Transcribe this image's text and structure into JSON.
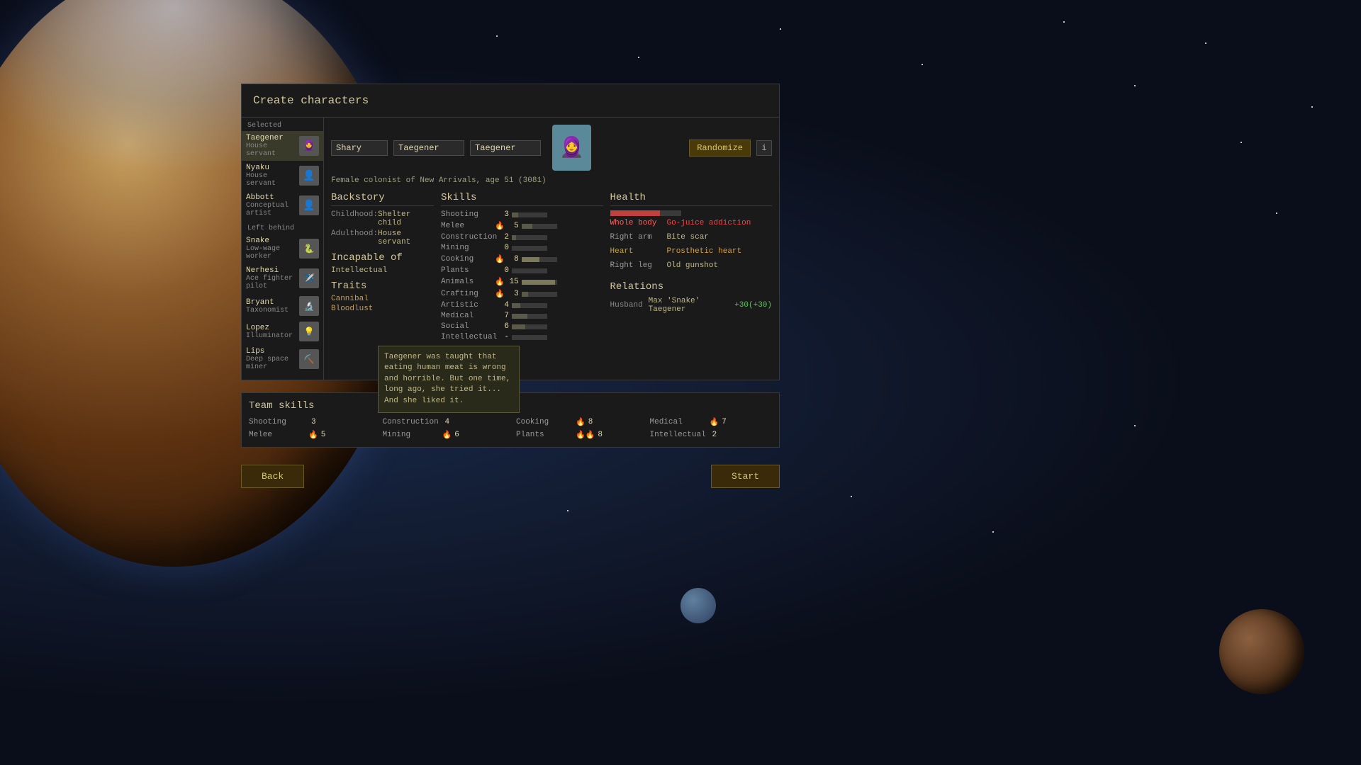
{
  "window": {
    "title": "Create characters"
  },
  "selected_label": "Selected",
  "left_behind_label": "Left behind",
  "characters": {
    "selected": [
      {
        "name": "Taegener",
        "role": "House servant",
        "avatar": "🧕",
        "active": true
      }
    ],
    "left_behind": [
      {
        "name": "Nyaku",
        "role": "House servant",
        "avatar": "👤"
      },
      {
        "name": "Abbott",
        "role": "Conceptual artist",
        "avatar": "👤"
      },
      {
        "name": "Snake",
        "role": "Low-wage worker",
        "avatar": "🐍"
      },
      {
        "name": "Nerhesi",
        "role": "Ace fighter pilot",
        "avatar": "✈️"
      },
      {
        "name": "Bryant",
        "role": "Taxonomist",
        "avatar": "🔬"
      },
      {
        "name": "Lopez",
        "role": "Illuminator",
        "avatar": "💡"
      },
      {
        "name": "Lips",
        "role": "Deep space miner",
        "avatar": "⛏️"
      }
    ]
  },
  "character": {
    "first_name": "Shary",
    "last_name": "Taegener",
    "nick_name": "Taegener",
    "description": "Female colonist of New Arrivals, age 51 (3081)",
    "portrait_emoji": "🧕"
  },
  "buttons": {
    "randomize": "Randomize",
    "info": "i",
    "back": "Back",
    "start": "Start"
  },
  "backstory": {
    "title": "Backstory",
    "childhood_label": "Childhood:",
    "childhood_value": "Shelter child",
    "adulthood_label": "Adulthood:",
    "adulthood_value": "House servant"
  },
  "incapable": {
    "title": "Incapable of",
    "items": [
      "Intellectual"
    ]
  },
  "traits": {
    "title": "Traits",
    "items": [
      "Cannibal",
      "Bloodlust"
    ]
  },
  "skills": {
    "title": "Skills",
    "items": [
      {
        "name": "Shooting",
        "icon": "",
        "value": 3,
        "bar": 18
      },
      {
        "name": "Melee",
        "icon": "🔥",
        "value": 5,
        "bar": 30
      },
      {
        "name": "Construction",
        "icon": "",
        "value": 2,
        "bar": 12
      },
      {
        "name": "Mining",
        "icon": "",
        "value": 0,
        "bar": 0
      },
      {
        "name": "Cooking",
        "icon": "🔥",
        "value": 8,
        "bar": 50
      },
      {
        "name": "Plants",
        "icon": "",
        "value": 0,
        "bar": 0
      },
      {
        "name": "Animals",
        "icon": "🔥",
        "value": 15,
        "bar": 95
      },
      {
        "name": "Crafting",
        "icon": "🔥",
        "value": 3,
        "bar": 18
      },
      {
        "name": "Artistic",
        "icon": "",
        "value": 4,
        "bar": 24
      },
      {
        "name": "Medical",
        "icon": "",
        "value": 7,
        "bar": 44
      },
      {
        "name": "Social",
        "icon": "",
        "value": 6,
        "bar": 37
      },
      {
        "name": "Intellectual",
        "icon": "",
        "value": "-",
        "bar": 0
      }
    ]
  },
  "health": {
    "title": "Health",
    "items": [
      {
        "part": "Whole body",
        "condition": "Go-juice addiction",
        "part_color": "red",
        "cond_color": "red"
      },
      {
        "part": "Right arm",
        "condition": "Bite scar",
        "part_color": "normal",
        "cond_color": "normal"
      },
      {
        "part": "Heart",
        "condition": "Prosthetic heart",
        "part_color": "yellow",
        "cond_color": "yellow"
      },
      {
        "part": "Right leg",
        "condition": "Old gunshot",
        "part_color": "normal",
        "cond_color": "normal"
      }
    ]
  },
  "relations": {
    "title": "Relations",
    "items": [
      {
        "type": "Husband",
        "name": "Max 'Snake' Taegener",
        "value": "+30(+30)"
      }
    ]
  },
  "tooltip": {
    "text": "Taegener was taught that eating human meat is wrong and horrible. But one time, long ago, she tried it... And she liked it."
  },
  "team_skills": {
    "title": "Team skills",
    "items": [
      {
        "name": "Shooting",
        "icon": "",
        "value": 3
      },
      {
        "name": "Melee",
        "icon": "🔥",
        "value": 5
      },
      {
        "name": "Construction",
        "icon": "",
        "value": 4
      },
      {
        "name": "Mining",
        "icon": "🔥",
        "value": 6
      },
      {
        "name": "Cooking",
        "icon": "🔥",
        "value": 8
      },
      {
        "name": "Plants",
        "icon": "🔥🔥",
        "value": 8
      },
      {
        "name": "Medical",
        "icon": "🔥",
        "value": 7
      },
      {
        "name": "Intellectual",
        "icon": "",
        "value": 2
      }
    ]
  }
}
